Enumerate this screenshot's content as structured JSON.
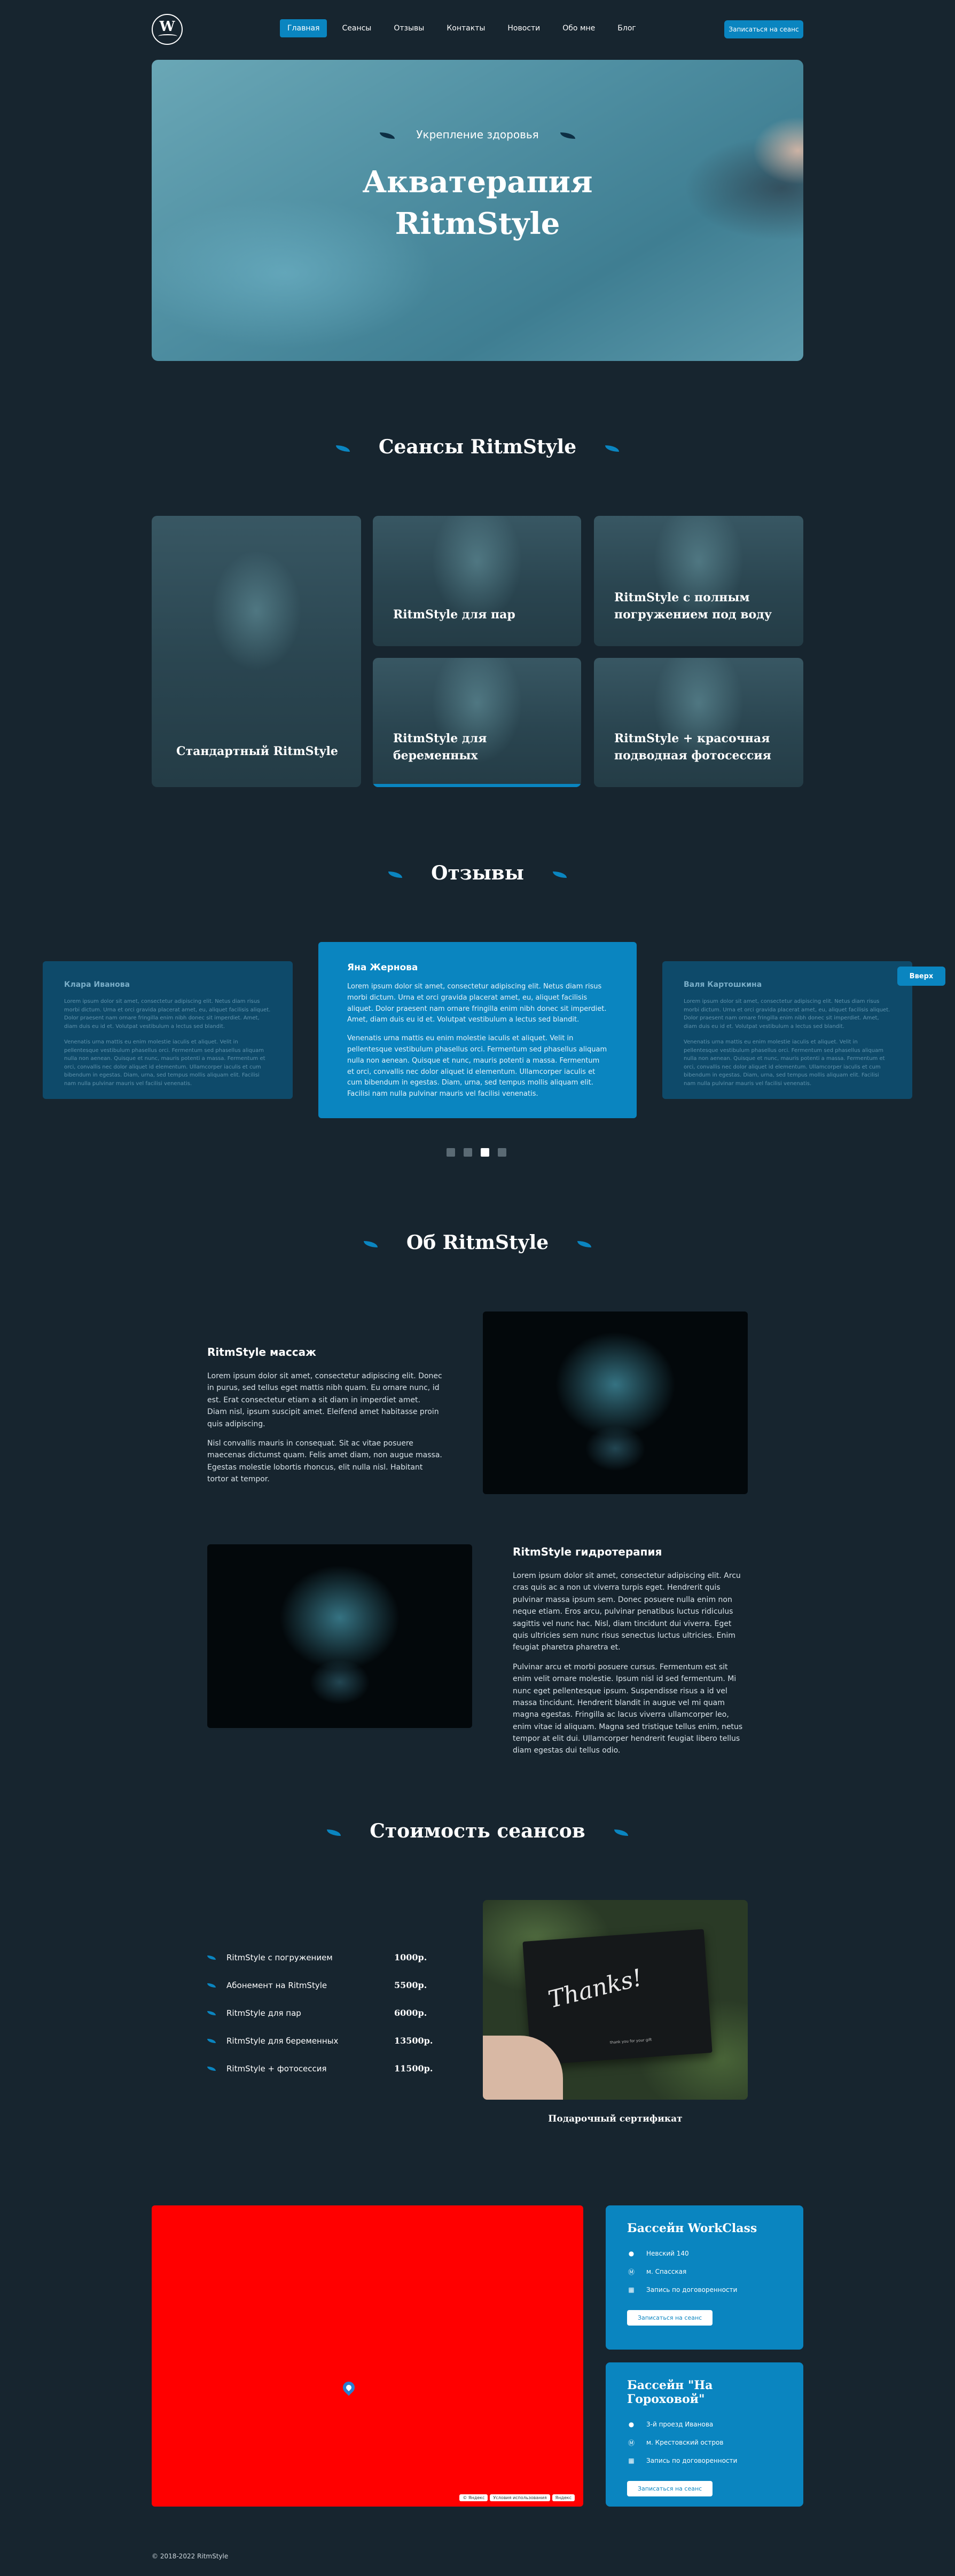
{
  "header": {
    "logo_letter": "W",
    "nav": [
      "Главная",
      "Сеансы",
      "Отзывы",
      "Контакты",
      "Новости",
      "Обо мне",
      "Блог"
    ],
    "cta": "Записаться на сеанс"
  },
  "hero": {
    "tag": "Укрепление здоровья",
    "title_line1": "Акватерапия",
    "title_line2": "RitmStyle"
  },
  "sessions": {
    "title": "Сеансы RitmStyle",
    "cards": [
      "Стандартный RitmStyle",
      "RitmStyle для пар",
      "RitmStyle с полным погружением под воду",
      "RitmStyle для беременных",
      "RitmStyle + красочная подводная фотосессия"
    ]
  },
  "reviews": {
    "title": "Отзывы",
    "items": [
      {
        "name": "Клара Иванова",
        "p1": "Lorem ipsum dolor sit amet, consectetur adipiscing elit. Netus diam risus morbi dictum. Urna et orci gravida placerat amet, eu, aliquet facilisis aliquet. Dolor praesent nam ornare fringilla enim nibh donec sit imperdiet. Amet, diam duis eu id et. Volutpat vestibulum a lectus sed blandit.",
        "p2": "Venenatis urna mattis eu enim molestie iaculis et aliquet. Velit in pellentesque vestibulum phasellus orci. Fermentum sed phasellus aliquam nulla non aenean. Quisque et nunc, mauris potenti a massa. Fermentum et orci, convallis nec dolor aliquet id elementum. Ullamcorper iaculis et cum bibendum in egestas. Diam, urna, sed tempus mollis aliquam elit. Facilisi nam nulla pulvinar mauris vel facilisi venenatis."
      },
      {
        "name": "Яна Жернова",
        "p1": "Lorem ipsum dolor sit amet, consectetur adipiscing elit. Netus diam risus morbi dictum. Urna et orci gravida placerat amet, eu, aliquet facilisis aliquet. Dolor praesent nam ornare fringilla enim nibh donec sit imperdiet. Amet, diam duis eu id et. Volutpat vestibulum a lectus sed blandit.",
        "p2": "Venenatis urna mattis eu enim molestie iaculis et aliquet. Velit in pellentesque vestibulum phasellus orci. Fermentum sed phasellus aliquam nulla non aenean. Quisque et nunc, mauris potenti a massa. Fermentum et orci, convallis nec dolor aliquet id elementum. Ullamcorper iaculis et cum bibendum in egestas. Diam, urna, sed tempus mollis aliquam elit. Facilisi nam nulla pulvinar mauris vel facilisi venenatis."
      },
      {
        "name": "Валя Картошкина",
        "p1": "Lorem ipsum dolor sit amet, consectetur adipiscing elit. Netus diam risus morbi dictum. Urna et orci gravida placerat amet, eu, aliquet facilisis aliquet. Dolor praesent nam ornare fringilla enim nibh donec sit imperdiet. Amet, diam duis eu id et. Volutpat vestibulum a lectus sed blandit.",
        "p2": "Venenatis urna mattis eu enim molestie iaculis et aliquet. Velit in pellentesque vestibulum phasellus orci. Fermentum sed phasellus aliquam nulla non aenean. Quisque et nunc, mauris potenti a massa. Fermentum et orci, convallis nec dolor aliquet id elementum. Ullamcorper iaculis et cum bibendum in egestas. Diam, urna, sed tempus mollis aliquam elit. Facilisi nam nulla pulvinar mauris vel facilisi venenatis."
      }
    ],
    "up_button": "Вверх"
  },
  "about": {
    "title": "Об RitmStyle",
    "block1": {
      "heading": "RitmStyle массаж",
      "p1": "Lorem ipsum dolor sit amet, consectetur adipiscing elit. Donec in purus, sed tellus eget mattis nibh quam. Eu ornare nunc, id est. Erat consectetur etiam a sit diam in imperdiet amet. Diam nisl, ipsum suscipit amet. Eleifend amet habitasse proin quis adipiscing.",
      "p2": "Nisl convallis mauris in consequat. Sit ac vitae posuere maecenas dictumst quam. Felis amet diam, non augue massa. Egestas molestie lobortis rhoncus, elit nulla nisl. Habitant tortor at tempor."
    },
    "block2": {
      "heading": "RitmStyle гидротерапия",
      "p1": "Lorem ipsum dolor sit amet, consectetur adipiscing elit. Arcu cras quis ac a non ut viverra turpis eget. Hendrerit quis pulvinar massa ipsum sem. Donec posuere nulla enim non neque etiam. Eros arcu, pulvinar penatibus luctus ridiculus sagittis vel nunc hac. Nisl, diam tincidunt dui viverra. Eget quis ultricies sem nunc risus senectus luctus ultricies. Enim feugiat pharetra pharetra et.",
      "p2": "Pulvinar arcu et morbi posuere cursus. Fermentum est sit enim velit ornare molestie. Ipsum nisl id sed fermentum. Mi nunc eget pellentesque ipsum. Suspendisse risus a id vel massa tincidunt. Hendrerit blandit in augue vel mi quam magna egestas. Fringilla ac lacus viverra ullamcorper leo, enim vitae id aliquam. Magna sed tristique tellus enim, netus tempor at elit dui. Ullamcorper hendrerit feugiat libero tellus diam egestas dui tellus odio."
    }
  },
  "prices": {
    "title": "Стоимость сеансов",
    "rows": [
      {
        "name": "RitmStyle с погружением",
        "price": "1000р."
      },
      {
        "name": "Абонемент на RitmStyle",
        "price": "5500р."
      },
      {
        "name": "RitmStyle для пар",
        "price": "6000р."
      },
      {
        "name": "RitmStyle для беременных",
        "price": "13500р."
      },
      {
        "name": "RitmStyle + фотосессия",
        "price": "11500р."
      }
    ],
    "gift_text": "Thanks!",
    "gift_small": "thank you for your gift",
    "gift_caption": "Подарочный сертификат"
  },
  "map": {
    "footer": [
      "© Яндекс",
      "Условия использования",
      "Яндекс"
    ]
  },
  "pools": [
    {
      "name": "Бассейн WorkClass",
      "address": "Невский 140",
      "metro": "м. Спасская",
      "schedule": "Запись по договоренности",
      "button": "Записаться на сеанс"
    },
    {
      "name": "Бассейн \"На Гороховой\"",
      "address": "3-й проезд Иванова",
      "metro": "м. Крестовский остров",
      "schedule": "Запись по договоренности",
      "button": "Записаться на сеанс"
    }
  ],
  "footer": {
    "copyright": "© 2018-2022 RitmStyle"
  },
  "colors": {
    "background": "#17252f",
    "accent": "#0a85c0",
    "review_card": "#0e4a6a",
    "map": "#ff0000"
  },
  "icons": [
    "wave-logo-icon",
    "leaf-icon",
    "location-icon",
    "metro-icon",
    "calendar-icon",
    "map-pin-icon"
  ]
}
